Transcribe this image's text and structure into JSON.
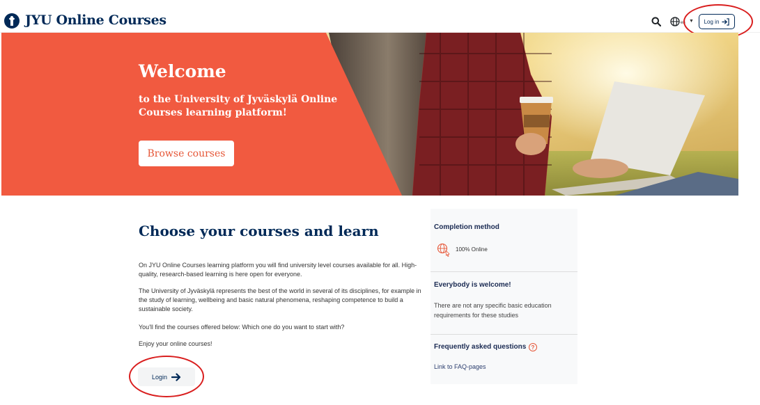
{
  "header": {
    "brand": "JYU Online Courses",
    "language_code": "en",
    "login_label": "Log in"
  },
  "hero": {
    "title": "Welcome",
    "subtitle": "to the University of Jyväskylä Online Courses learning platform!",
    "browse_label": "Browse courses"
  },
  "main": {
    "title": "Choose your courses and learn",
    "paragraphs": [
      "On JYU Online Courses learning platform you will find university level courses available for all. High-quality, research-based learning is here open for everyone.",
      "The University of Jyväskylä represents the best of the world in several of its disciplines, for example in the study of learning, wellbeing and basic natural phenomena, reshaping competence to build a sustainable society.",
      "You'll find the courses offered below: Which one do you want to start with?",
      "Enjoy your online courses!"
    ],
    "login_label": "Login"
  },
  "sidebar": {
    "completion_heading": "Completion method",
    "completion_value": "100% Online",
    "welcome_heading": "Everybody is welcome!",
    "welcome_text": "There are not any specific basic education requirements for these studies",
    "faq_heading": "Frequently asked questions",
    "faq_link": "Link to FAQ-pages"
  },
  "colors": {
    "brand_navy": "#002957",
    "hero_orange": "#f15a40",
    "annotation_red": "#d91e1e"
  },
  "icons": {
    "search": "search-icon",
    "language": "globe-icon",
    "login": "login-arrow-icon",
    "completion": "globe-online-icon",
    "faq": "question-circle-icon"
  }
}
